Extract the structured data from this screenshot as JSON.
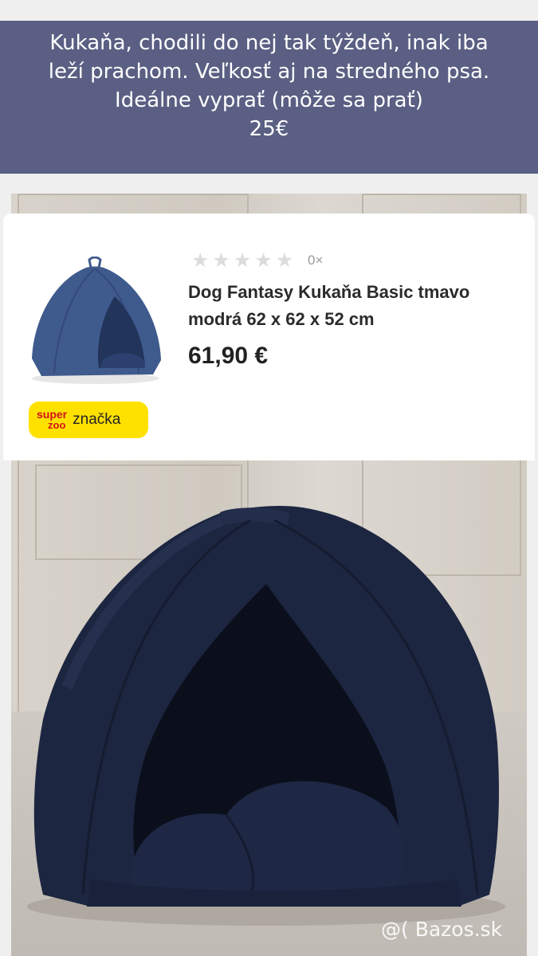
{
  "listing": {
    "caption_lines": [
      "Kukaňa, chodili do nej tak týždeň, inak iba",
      "leží prachom. Veľkosť aj na stredného psa.",
      "Ideálne vyprať (môže sa prať)",
      "25€"
    ]
  },
  "product_card": {
    "rating_count": "0×",
    "title": "Dog Fantasy Kukaňa Basic tmavo modrá 62 x 62 x 52 cm",
    "price": "61,90 €",
    "brand_logo_text": [
      "super",
      "zoo"
    ],
    "brand_label": "značka"
  },
  "watermark": "@( Bazos.sk",
  "colors": {
    "caption_bg": "#5a5f83",
    "brand_badge": "#ffe100",
    "logo_red": "#d0121b",
    "tent_blue": "#1c2640"
  }
}
